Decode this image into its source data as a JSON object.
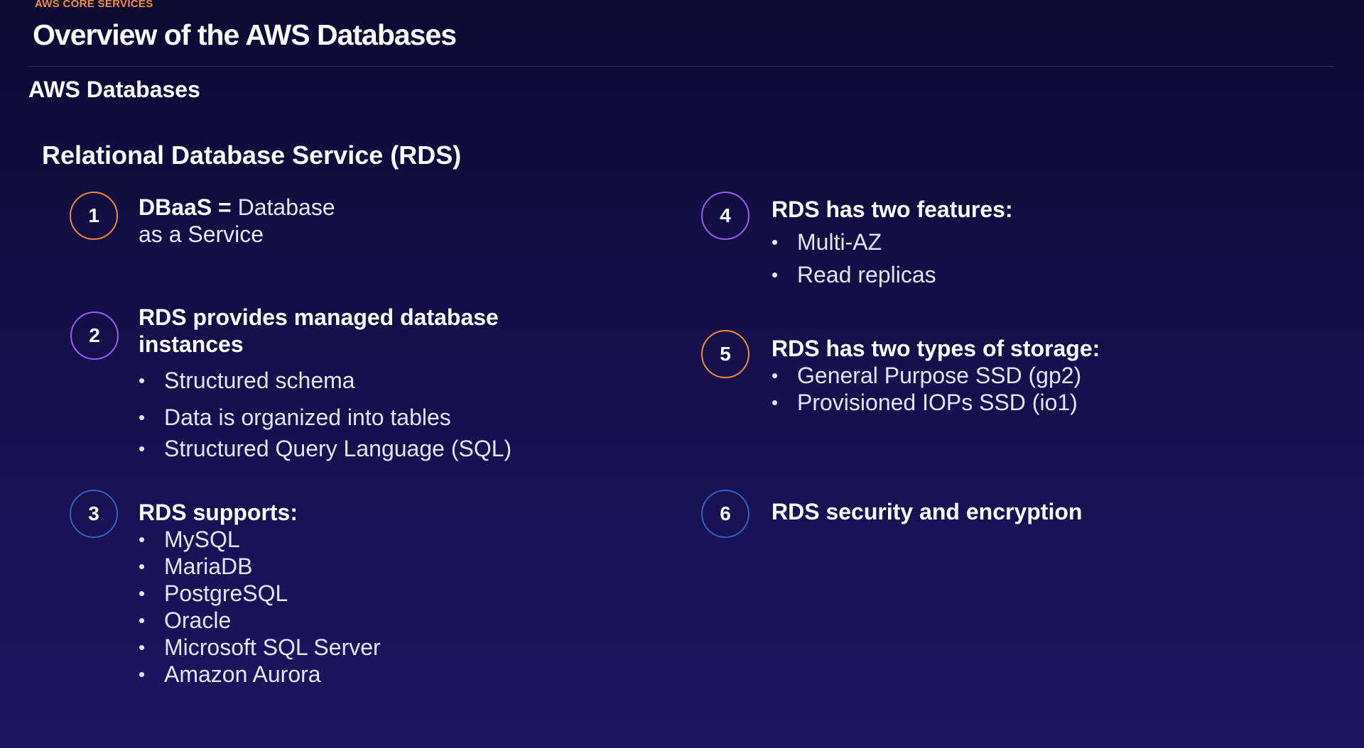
{
  "header": {
    "eyebrow": "AWS CORE SERVICES",
    "title": "Overview of the AWS Databases"
  },
  "section_title": "AWS Databases",
  "subsection_title": "Relational Database Service (RDS)",
  "items": [
    {
      "number": "1",
      "head_bold": "DBaaS = ",
      "head_normal": "Database",
      "head_line2": "as a Service",
      "bullets": []
    },
    {
      "number": "2",
      "head": "RDS provides managed database",
      "head_line2": "instances",
      "bullets": [
        "Structured schema",
        "Data is organized into tables",
        "Structured Query Language (SQL)"
      ]
    },
    {
      "number": "3",
      "head": "RDS supports:",
      "bullets": [
        "MySQL",
        "MariaDB",
        "PostgreSQL",
        "Oracle",
        "Microsoft SQL Server",
        "Amazon Aurora"
      ]
    },
    {
      "number": "4",
      "head": "RDS has two features:",
      "bullets": [
        "Multi-AZ",
        "Read replicas"
      ]
    },
    {
      "number": "5",
      "head": "RDS has two types of storage:",
      "bullets": [
        "General Purpose SSD (gp2)",
        "Provisioned IOPs SSD (io1)"
      ]
    },
    {
      "number": "6",
      "head": "RDS security and encryption",
      "bullets": []
    }
  ],
  "colors": {
    "accent_orange": "#f08a3c",
    "accent_purple": "#9b5cf6",
    "accent_blue": "#2f62c4",
    "background": "#150f4a"
  }
}
